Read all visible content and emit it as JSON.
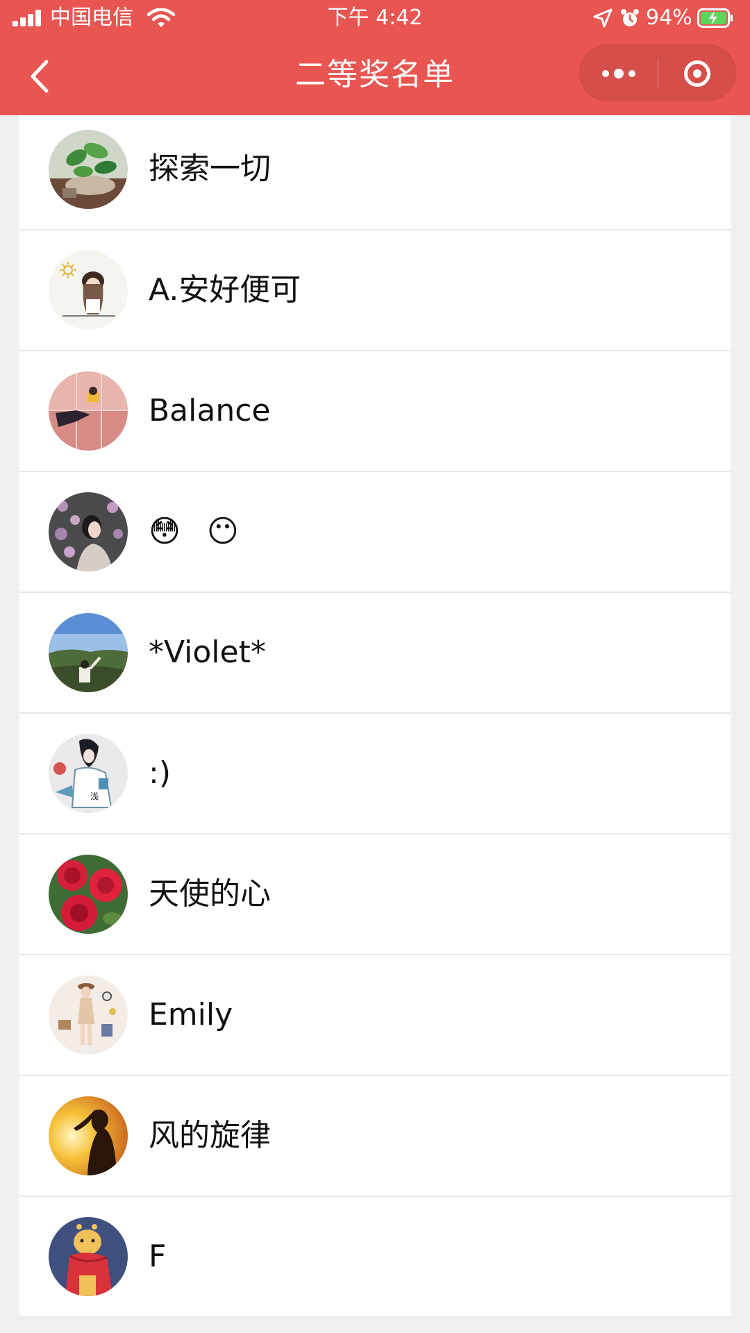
{
  "status_bar": {
    "carrier": "中国电信",
    "time": "下午 4:42",
    "battery_percent": "94%"
  },
  "nav": {
    "title": "二等奖名单"
  },
  "colors": {
    "header_bg": "#e95551",
    "list_bg": "#ffffff",
    "page_bg": "#f0f0f0",
    "divider": "#e8e8e8",
    "text": "#111111"
  },
  "winners": [
    {
      "name": "探索一切",
      "avatar": "plant-photo"
    },
    {
      "name": "A.安好便可",
      "avatar": "cartoon-girl-sun"
    },
    {
      "name": "Balance",
      "avatar": "pink-wall-photo"
    },
    {
      "name": "😳 😶",
      "avatar": "flower-portrait"
    },
    {
      "name": "*Violet*",
      "avatar": "landscape-photo"
    },
    {
      "name": ":)",
      "avatar": "illustration-girl"
    },
    {
      "name": "天使的心",
      "avatar": "red-roses"
    },
    {
      "name": "Emily",
      "avatar": "fashion-illustration"
    },
    {
      "name": "风的旋律",
      "avatar": "sunset-silhouette"
    },
    {
      "name": "F",
      "avatar": "cartoon-giraffe"
    }
  ]
}
